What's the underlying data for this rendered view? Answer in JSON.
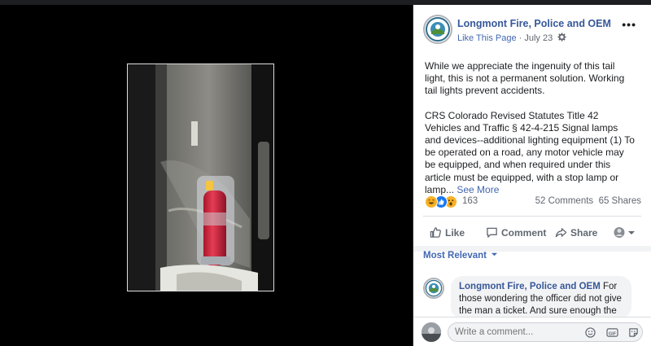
{
  "post": {
    "page_name": "Longmont Fire, Police and OEM",
    "like_page": "Like This Page",
    "separator": "·",
    "date": "July 23",
    "more_label": "•••",
    "paragraph_1": "While we appreciate the ingenuity of this tail light, this is not a permanent solution. Working tail lights prevent accidents.",
    "paragraph_2": "CRS Colorado Revised Statutes Title 42 Vehicles and Traffic § 42-4-215 Signal lamps and devices--additional lighting equipment (1) To be operated on a road, any motor vehicle may be equipped, and when required under this article must be equipped, with a stop lamp or lamp...",
    "see_more": "See More"
  },
  "reactions": {
    "count": "163",
    "icons": [
      "haha-icon",
      "like-icon",
      "wow-icon"
    ],
    "comments": "52 Comments",
    "shares": "65 Shares"
  },
  "actions": {
    "like": "Like",
    "comment": "Comment",
    "share": "Share"
  },
  "comments": {
    "sort_label": "Most Relevant",
    "items": [
      {
        "author": "Longmont Fire, Police and OEM",
        "text": "For those wondering the officer did not give the man a ticket. And sure enough the"
      }
    ]
  },
  "write_comment": {
    "placeholder": "Write a comment..."
  },
  "colors": {
    "brand_blue": "#4267b2",
    "link_blue": "#365899"
  }
}
